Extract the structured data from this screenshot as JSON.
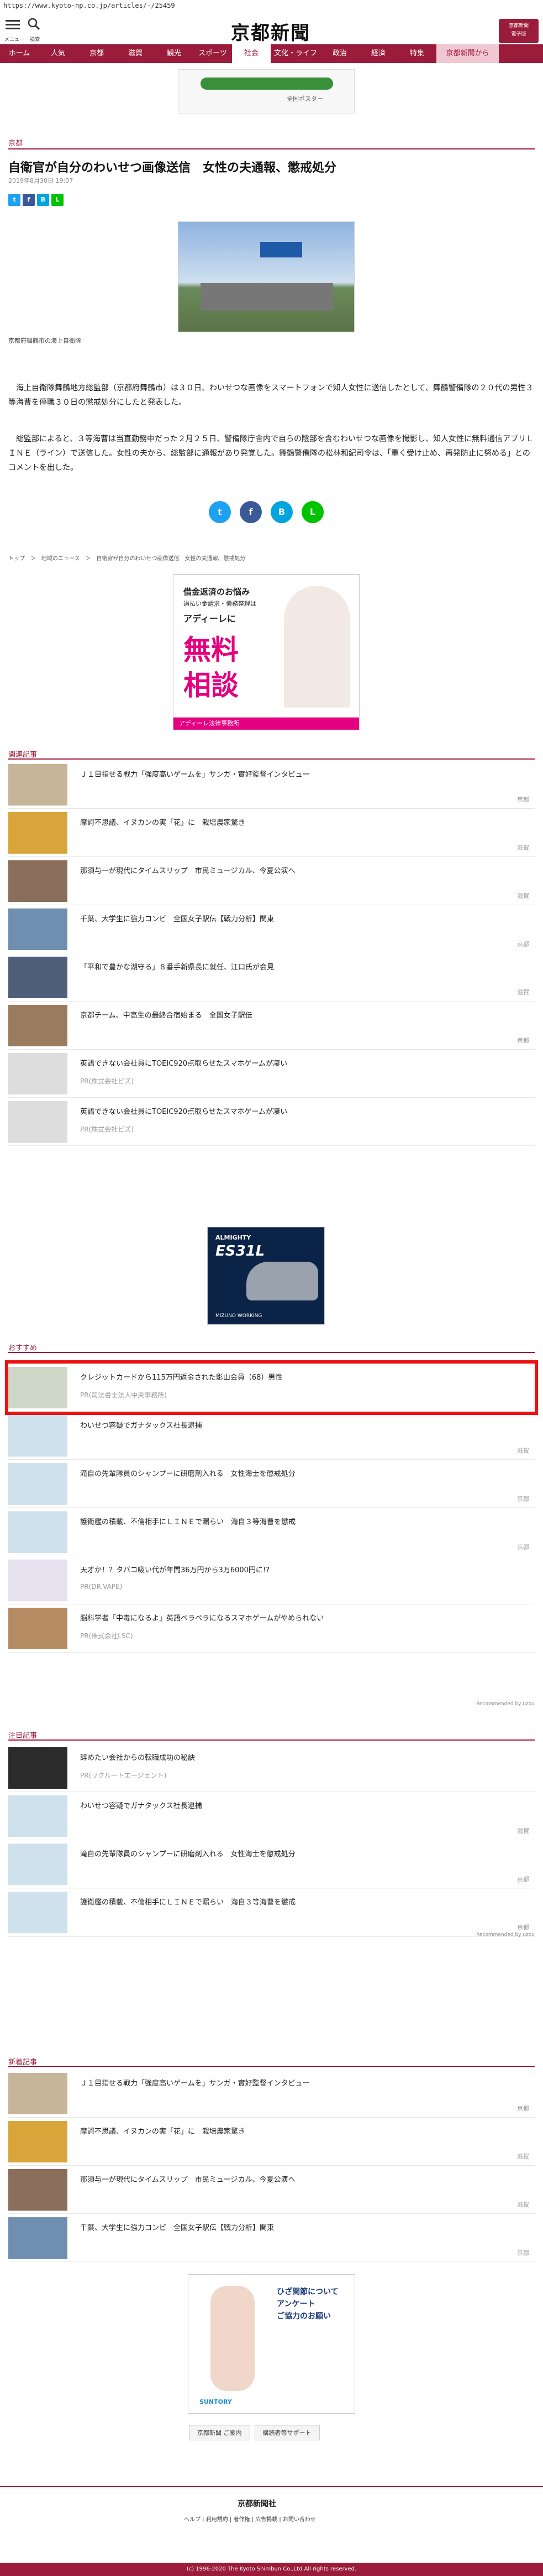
{
  "url": "https://www.kyoto-np.co.jp/articles/-/25459",
  "header": {
    "menu_label": "メニュー",
    "search_label": "検索",
    "logo": "京都新聞",
    "edition_button": "京都新聞\n電子版"
  },
  "nav": [
    "ホーム",
    "人気",
    "京都",
    "滋賀",
    "観光",
    "スポーツ",
    "社会",
    "文化・ライフ",
    "政治",
    "経済",
    "特集",
    "京都新聞から"
  ],
  "ad_top": "全国ポスター",
  "article": {
    "category": "京都",
    "title": "自衛官が自分のわいせつ画像送信　女性の夫通報、懲戒処分",
    "date": "2019年8月30日 19:07",
    "caption": "京都府舞鶴市の海上自衛隊",
    "paragraphs": [
      "　海上自衛隊舞鶴地方総監部（京都府舞鶴市）は３０日、わいせつな画像をスマートフォンで知人女性に送信したとして、舞鶴警備隊の２０代の男性３等海曹を停職３０日の懲戒処分にしたと発表した。",
      "　総監部によると、３等海曹は当直勤務中だった２月２５日、警備隊庁舎内で自らの陰部を含むわいせつな画像を撮影し、知人女性に無料通信アプリＬＩＮＥ（ライン）で送信した。女性の夫から、総監部に通報があり発覚した。舞鶴警備隊の松林和紀司令は、「重く受け止め、再発防止に努める」とのコメントを出した。"
    ],
    "breadcrumb": "トップ　＞　地域のニュース　＞　自衛官が自分のわいせつ画像送信　女性の夫通報、懲戒処分"
  },
  "ad_middle": {
    "line1": "借金返済のお悩み",
    "line2": "過払い金請求・債務整理は",
    "brand": "アディーレに",
    "big1": "無料",
    "big2": "相談",
    "footer": "アディーレ法律事務所"
  },
  "related": {
    "heading": "関連記事",
    "items": [
      {
        "title": "Ｊ１目指せる戦力「強度高いゲームを」サンガ・實好監督インタビュー",
        "source": "京都",
        "pr": ""
      },
      {
        "title": "摩訶不思議、イヌカンの実「花」に　栽培農家驚き",
        "source": "滋賀",
        "pr": ""
      },
      {
        "title": "那須与一が現代にタイムスリップ　市民ミュージカル、今夏公演へ",
        "source": "滋賀",
        "pr": ""
      },
      {
        "title": "千葉、大学生に強力コンビ　全国女子駅伝【戦力分析】関東",
        "source": "京都",
        "pr": ""
      },
      {
        "title": "「平和で豊かな湖守る」８番手新県長に就任、江口氏が会見",
        "source": "滋賀",
        "pr": ""
      },
      {
        "title": "京都チーム、中高生の最終合宿始まる　全国女子駅伝",
        "source": "京都",
        "pr": ""
      },
      {
        "title": "英語できない会社員にTOEIC920点取らせたスマホゲームが凄い",
        "source": "",
        "pr": "PR(株式会社ビズ)"
      },
      {
        "title": "英語できない会社員にTOEIC920点取らせたスマホゲームが凄い",
        "source": "",
        "pr": "PR(株式会社ビズ)"
      }
    ]
  },
  "ad_shoe": {
    "brand": "ALMIGHTY",
    "model": "ES31L",
    "maker": "MIZUNO WORKING"
  },
  "recommended": {
    "heading": "おすすめ",
    "items": [
      {
        "title": "クレジットカードから115万円返金された影山会員（68）男性",
        "source": "",
        "pr": "PR(司法書士法人中央事務所)"
      },
      {
        "title": "わいせつ容疑でガナタックス社長逮捕",
        "source": "滋賀",
        "pr": ""
      },
      {
        "title": "滝自の先輩隊員のシャンプーに研磨剤入れる　女性海士を懲戒処分",
        "source": "京都",
        "pr": ""
      },
      {
        "title": "護衛艦の積載、不倫相手にＬＩＮＥで漏らい　海自３等海曹を懲戒",
        "source": "京都",
        "pr": ""
      },
      {
        "title": "天才か！？タバコ吸い代が年間36万円から3万6000円に!?",
        "source": "",
        "pr": "PR(DR.VAPE)"
      },
      {
        "title": "脳科学者「中毒になるよ」英語ペラペラになるスマホゲームがやめられない",
        "source": "",
        "pr": "PR(株式会社LSC)"
      }
    ],
    "credit": "Recommended by uzou"
  },
  "attention": {
    "heading": "注目記事",
    "items": [
      {
        "title": "辞めたい会社からの転職成功の秘訣",
        "source": "",
        "pr": "PR(リクルートエージェント)"
      },
      {
        "title": "わいせつ容疑でガナタックス社長逮捕",
        "source": "滋賀",
        "pr": ""
      },
      {
        "title": "滝自の先輩隊員のシャンプーに研磨剤入れる　女性海士を懲戒処分",
        "source": "京都",
        "pr": ""
      },
      {
        "title": "護衛艦の積載、不倫相手にＬＩＮＥで漏らい　海自３等海曹を懲戒",
        "source": "京都",
        "pr": ""
      }
    ],
    "credit": "Recommended by uzou"
  },
  "newest": {
    "heading": "新着記事",
    "items": [
      {
        "title": "Ｊ１目指せる戦力「強度高いゲームを」サンガ・實好監督インタビュー",
        "source": "京都",
        "pr": ""
      },
      {
        "title": "摩訶不思議、イヌカンの実「花」に　栽培農家驚き",
        "source": "滋賀",
        "pr": ""
      },
      {
        "title": "那須与一が現代にタイムスリップ　市民ミュージカル、今夏公演へ",
        "source": "滋賀",
        "pr": ""
      },
      {
        "title": "千葉、大学生に強力コンビ　全国女子駅伝【戦力分析】関東",
        "source": "京都",
        "pr": ""
      }
    ]
  },
  "ad_bottom": {
    "line1": "ひざ関節について",
    "line2": "アンケート",
    "line3": "ご協力のお願い",
    "brand": "SUNTORY"
  },
  "bottom_buttons": [
    "京都新聞 ご案内",
    "購読者等サポート"
  ],
  "footer": {
    "logo": "京都新聞社",
    "links": "ヘルプ | 利用規約 | 著作権 | 広告掲載 | お問い合わせ",
    "copyright": "(c) 1996-2020 The Kyoto Shimbun Co.,Ltd All rights reserved."
  }
}
